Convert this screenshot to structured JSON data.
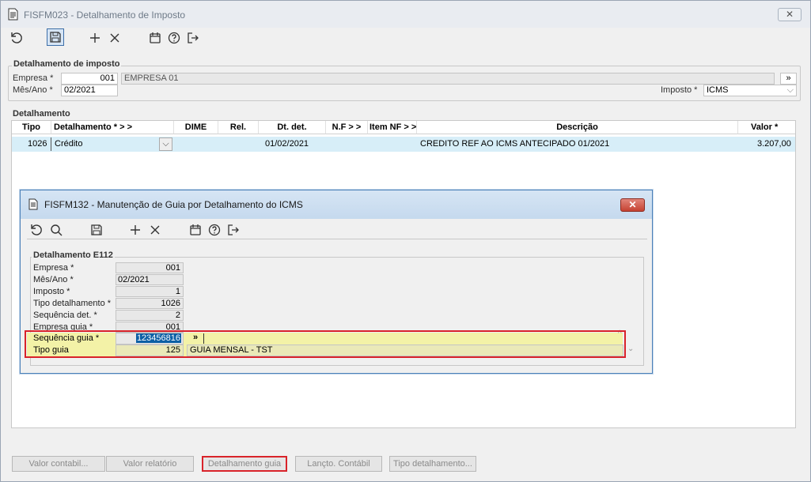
{
  "window": {
    "title": "FISFM023 - Detalhamento de Imposto",
    "close": "✕"
  },
  "group1": {
    "legend": "Detalhamento de imposto",
    "empresa_label": "Empresa *",
    "empresa_value": "001",
    "empresa_name": "EMPRESA 01",
    "mesano_label": "Mês/Ano *",
    "mesano_value": "02/2021",
    "imposto_label": "Imposto *",
    "imposto_value": "ICMS"
  },
  "group2": {
    "legend": "Detalhamento",
    "columns": [
      "Tipo",
      "Detalhamento *  > >",
      "DIME",
      "Rel.",
      "Dt. det.",
      "N.F  > >",
      "Item NF > >",
      "Descrição",
      "Valor *"
    ],
    "row": {
      "tipo": "1026",
      "detalhamento": "Crédito",
      "dt_det": "01/02/2021",
      "descricao": "CREDITO REF AO ICMS ANTECIPADO 01/2021",
      "valor": "3.207,00"
    }
  },
  "modal": {
    "title": "FISFM132 - Manutenção de Guia por Detalhamento do ICMS",
    "legend": "Detalhamento E112",
    "fields": [
      {
        "label": "Empresa *",
        "value": "001"
      },
      {
        "label": "Mês/Ano *",
        "value": "02/2021"
      },
      {
        "label": "Imposto *",
        "value": "1"
      },
      {
        "label": "Tipo detalhamento *",
        "value": "1026"
      },
      {
        "label": "Sequência det. *",
        "value": "2"
      },
      {
        "label": "Empresa guia *",
        "value": "001"
      }
    ],
    "seq_guia_label": "Sequência guia *",
    "seq_guia_value": "123456816",
    "lookup": "»",
    "tipo_guia_label": "Tipo guia",
    "tipo_guia_value": "125",
    "tipo_guia_desc": "GUIA MENSAL - TST"
  },
  "buttons": [
    "Valor contabil...",
    "Valor relatório",
    "Detalhamento guia",
    "Lançto. Contábil",
    "Tipo detalhamento..."
  ],
  "colors": {
    "highlight_red": "#d9232a",
    "row_blue": "#d7eef8",
    "yellow": "#f3f2a7"
  }
}
